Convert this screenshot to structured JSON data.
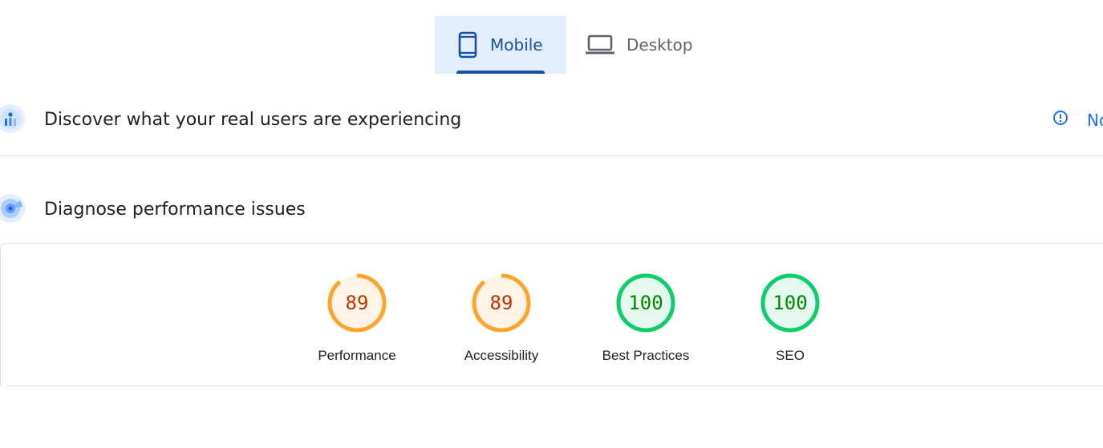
{
  "tabs": [
    {
      "label": "Mobile",
      "icon": "smartphone-icon",
      "active": true
    },
    {
      "label": "Desktop",
      "icon": "laptop-icon",
      "active": false
    }
  ],
  "sections": {
    "field_data": {
      "title": "Discover what your real users are experiencing",
      "icon": "crux-users-icon",
      "notice_text": "No"
    },
    "lab_data": {
      "title": "Diagnose performance issues",
      "icon": "lighthouse-target-icon"
    }
  },
  "scores": [
    {
      "label": "Performance",
      "value": "89",
      "score": 0.89,
      "rating": "average"
    },
    {
      "label": "Accessibility",
      "value": "89",
      "score": 0.89,
      "rating": "average"
    },
    {
      "label": "Best Practices",
      "value": "100",
      "score": 1.0,
      "rating": "pass"
    },
    {
      "label": "SEO",
      "value": "100",
      "score": 1.0,
      "rating": "pass"
    }
  ],
  "colors": {
    "accent": "#1a4fa5",
    "average_stroke": "#ffa32b",
    "average_fill": "#fff4e6",
    "average_text": "#c33300",
    "pass_stroke": "#0cce6b",
    "pass_fill": "#e6f9ef",
    "pass_text": "#008800"
  }
}
